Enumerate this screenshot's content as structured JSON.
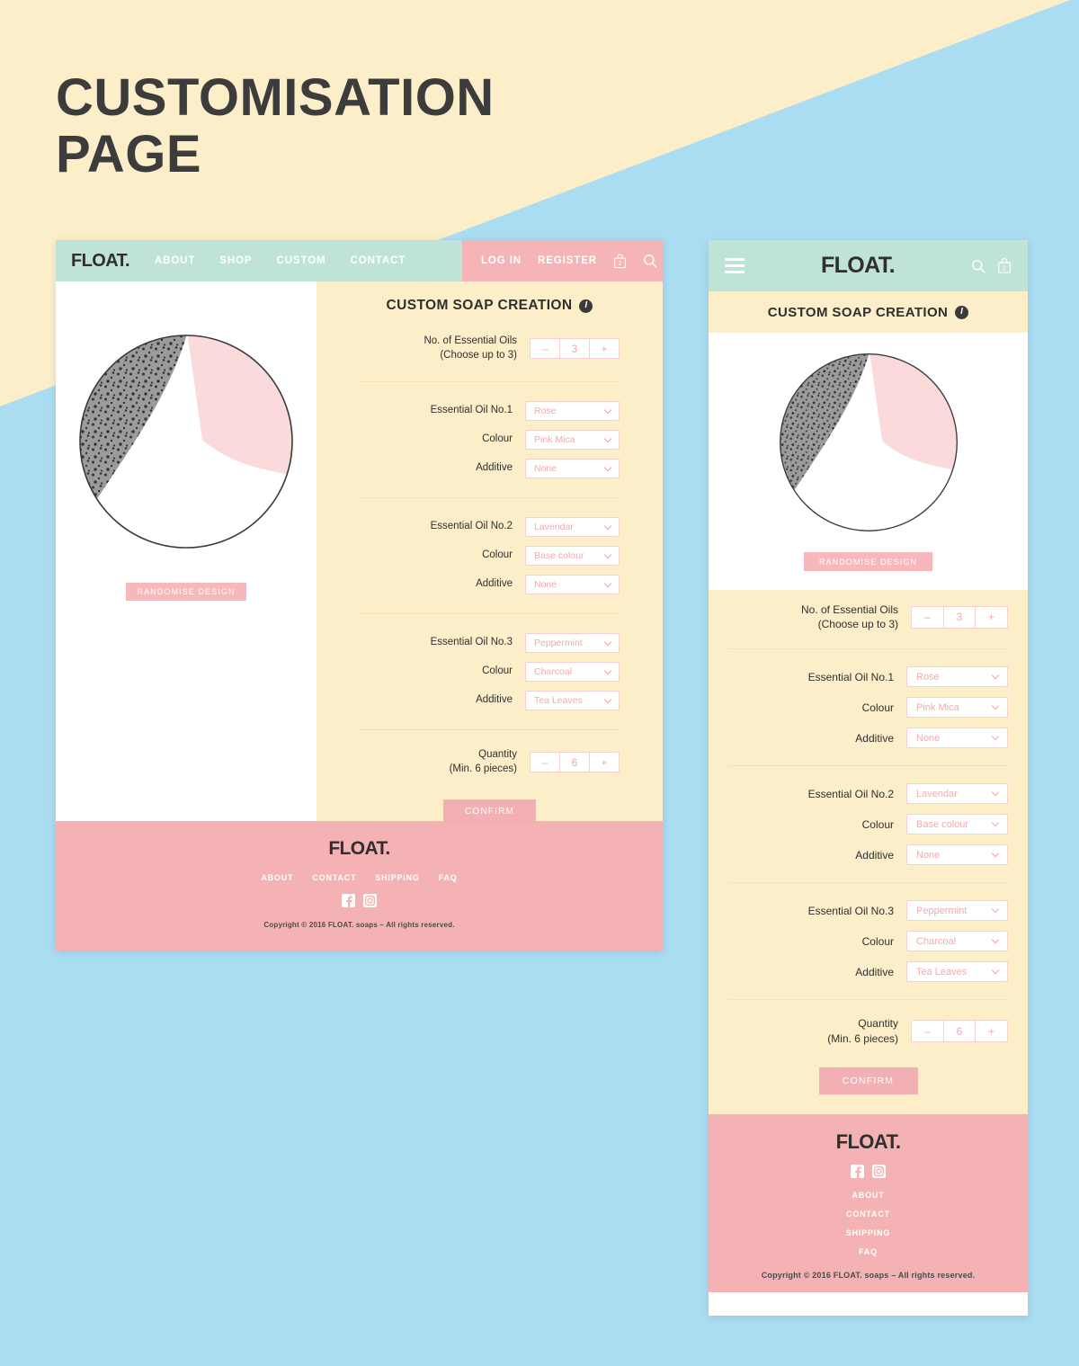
{
  "page": {
    "title": "CUSTOMISATION\nPAGE",
    "bg_cream": "#fbeec8",
    "bg_blue": "#aadcf2"
  },
  "brand": "FLOAT.",
  "desktop": {
    "nav": {
      "links": [
        "ABOUT",
        "SHOP",
        "CUSTOM",
        "CONTACT"
      ],
      "auth": [
        "LOG IN",
        "REGISTER"
      ],
      "cart_count": "2",
      "cart_icon": "shopping-bag-icon",
      "search_icon": "search-icon"
    },
    "preview": {
      "randomise_label": "RANDOMISE DESIGN",
      "soap_colors": {
        "speckled": "#9b9b9b",
        "pink": "#fadadb",
        "base": "#ffffff",
        "outline": "#3a3a3a",
        "speck": "#2b2b2b"
      }
    },
    "form": {
      "heading": "CUSTOM SOAP CREATION",
      "info_icon": "info-icon",
      "count": {
        "label": "No. of Essential Oils\n(Choose up to 3)",
        "minus": "–",
        "value": "3",
        "plus": "+"
      },
      "groups": [
        {
          "oil_label": "Essential Oil No.1",
          "oil_value": "Rose",
          "colour_label": "Colour",
          "colour_value": "Pink Mica",
          "additive_label": "Additive",
          "additive_value": "None"
        },
        {
          "oil_label": "Essential Oil No.2",
          "oil_value": "Lavendar",
          "colour_label": "Colour",
          "colour_value": "Base colour",
          "additive_label": "Additive",
          "additive_value": "None"
        },
        {
          "oil_label": "Essential Oil No.3",
          "oil_value": "Peppermint",
          "colour_label": "Colour",
          "colour_value": "Charcoal",
          "additive_label": "Additive",
          "additive_value": "Tea Leaves"
        }
      ],
      "quantity": {
        "label": "Quantity\n(Min. 6 pieces)",
        "minus": "–",
        "value": "6",
        "plus": "+"
      },
      "confirm_label": "CONFIRM"
    },
    "footer": {
      "brand": "FLOAT.",
      "links": [
        "ABOUT",
        "CONTACT",
        "SHIPPING",
        "FAQ"
      ],
      "social": [
        "facebook-icon",
        "instagram-icon"
      ],
      "copyright": "Copyright © 2016 FLOAT. soaps – All rights reserved."
    }
  },
  "mobile": {
    "nav": {
      "menu_icon": "hamburger-menu-icon",
      "brand": "FLOAT.",
      "search_icon": "search-icon",
      "cart_icon": "shopping-bag-icon",
      "cart_count": "2"
    },
    "heading": "CUSTOM SOAP CREATION",
    "info_icon": "info-icon",
    "preview": {
      "randomise_label": "RANDOMISE DESIGN"
    },
    "form": {
      "count": {
        "label": "No. of Essential Oils\n(Choose up to 3)",
        "minus": "–",
        "value": "3",
        "plus": "+"
      },
      "groups": [
        {
          "oil_label": "Essential Oil No.1",
          "oil_value": "Rose",
          "colour_label": "Colour",
          "colour_value": "Pink Mica",
          "additive_label": "Additive",
          "additive_value": "None"
        },
        {
          "oil_label": "Essential Oil No.2",
          "oil_value": "Lavendar",
          "colour_label": "Colour",
          "colour_value": "Base colour",
          "additive_label": "Additive",
          "additive_value": "None"
        },
        {
          "oil_label": "Essential Oil No.3",
          "oil_value": "Peppermint",
          "colour_label": "Colour",
          "colour_value": "Charcoal",
          "additive_label": "Additive",
          "additive_value": "Tea Leaves"
        }
      ],
      "quantity": {
        "label": "Quantity\n(Min. 6 pieces)",
        "minus": "–",
        "value": "6",
        "plus": "+"
      },
      "confirm_label": "CONFIRM"
    },
    "footer": {
      "brand": "FLOAT.",
      "social": [
        "facebook-icon",
        "instagram-icon"
      ],
      "links": [
        "ABOUT",
        "CONTACT",
        "SHIPPING",
        "FAQ"
      ],
      "copyright": "Copyright © 2016 FLOAT. soaps – All rights reserved."
    }
  },
  "theme": {
    "mint": "#bfe3d7",
    "pink": "#f5b2b5",
    "cream": "#fbeec8",
    "accent_pink": "#f3aaae",
    "dark": "#2f2f2f"
  }
}
